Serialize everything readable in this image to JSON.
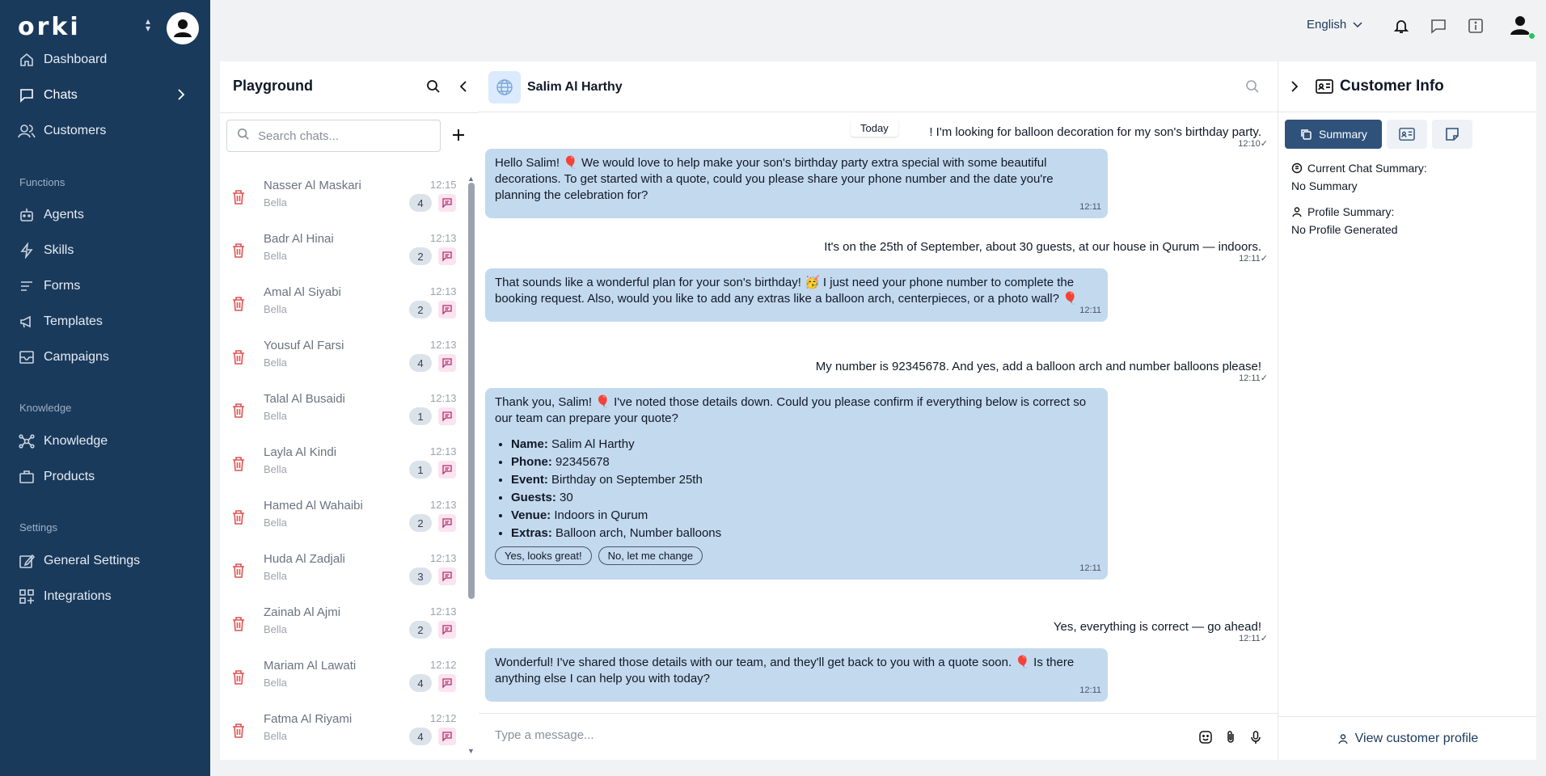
{
  "brand": {
    "logo": "orki"
  },
  "sidebar": {
    "items": [
      {
        "label": "Dashboard",
        "icon": "home-icon"
      },
      {
        "label": "Chats",
        "icon": "chat-icon"
      },
      {
        "label": "Customers",
        "icon": "users-icon"
      },
      {
        "label": "Agents",
        "icon": "robot-icon"
      },
      {
        "label": "Skills",
        "icon": "lightning-icon"
      },
      {
        "label": "Forms",
        "icon": "form-icon"
      },
      {
        "label": "Templates",
        "icon": "megaphone-icon"
      },
      {
        "label": "Campaigns",
        "icon": "mail-icon"
      },
      {
        "label": "Knowledge",
        "icon": "network-icon"
      },
      {
        "label": "Products",
        "icon": "briefcase-icon"
      },
      {
        "label": "General Settings",
        "icon": "pencil-icon"
      },
      {
        "label": "Integrations",
        "icon": "grid-plus-icon"
      }
    ],
    "sections": {
      "functions": "Functions",
      "knowledge": "Knowledge",
      "settings": "Settings"
    }
  },
  "topbar": {
    "language": "English"
  },
  "chat_list": {
    "title": "Playground",
    "search_placeholder": "Search chats...",
    "items": [
      {
        "name": "Nasser Al Maskari",
        "agent": "Bella",
        "time": "12:15",
        "count": "4"
      },
      {
        "name": "Badr Al Hinai",
        "agent": "Bella",
        "time": "12:13",
        "count": "2"
      },
      {
        "name": "Amal Al Siyabi",
        "agent": "Bella",
        "time": "12:13",
        "count": "2"
      },
      {
        "name": "Yousuf Al Farsi",
        "agent": "Bella",
        "time": "12:13",
        "count": "4"
      },
      {
        "name": "Talal Al Busaidi",
        "agent": "Bella",
        "time": "12:13",
        "count": "1"
      },
      {
        "name": "Layla Al Kindi",
        "agent": "Bella",
        "time": "12:13",
        "count": "1"
      },
      {
        "name": "Hamed Al Wahaibi",
        "agent": "Bella",
        "time": "12:13",
        "count": "2"
      },
      {
        "name": "Huda Al Zadjali",
        "agent": "Bella",
        "time": "12:13",
        "count": "3"
      },
      {
        "name": "Zainab Al Ajmi",
        "agent": "Bella",
        "time": "12:13",
        "count": "2"
      },
      {
        "name": "Mariam Al Lawati",
        "agent": "Bella",
        "time": "12:12",
        "count": "4"
      },
      {
        "name": "Fatma Al Riyami",
        "agent": "Bella",
        "time": "12:12",
        "count": "4"
      }
    ]
  },
  "chat": {
    "contact_name": "Salim Al Harthy",
    "date_pill": "Today",
    "composer_placeholder": "Type a message...",
    "messages": [
      {
        "from": "user",
        "text": "! I'm looking for balloon decoration for my son's birthday party.",
        "time": "12:10"
      },
      {
        "from": "bot",
        "text": "Hello Salim! 🎈 We would love to help make your son's birthday party extra special with some beautiful decorations. To get started with a quote, could you please share your phone number and the date you're planning the celebration for?",
        "time": "12:11"
      },
      {
        "from": "user",
        "text": "It's on the 25th of September, about 30 guests, at our house in Qurum — indoors.",
        "time": "12:11"
      },
      {
        "from": "bot",
        "text": "That sounds like a wonderful plan for your son's birthday! 🥳 I just need your phone number to complete the booking request. Also, would you like to add any extras like a balloon arch, centerpieces, or a photo wall? 🎈",
        "time": "12:11"
      },
      {
        "from": "user",
        "text": "My number is 92345678. And yes, add a balloon arch and number balloons please!",
        "time": "12:11"
      },
      {
        "from": "bot",
        "text": "Thank you, Salim! 🎈 I've noted those details down. Could you please confirm if everything below is correct so our team can prepare your quote?",
        "time": "12:11",
        "details": [
          {
            "label": "Name:",
            "value": "Salim Al Harthy"
          },
          {
            "label": "Phone:",
            "value": "92345678"
          },
          {
            "label": "Event:",
            "value": "Birthday on September 25th"
          },
          {
            "label": "Guests:",
            "value": "30"
          },
          {
            "label": "Venue:",
            "value": "Indoors in Qurum"
          },
          {
            "label": "Extras:",
            "value": "Balloon arch, Number balloons"
          }
        ],
        "quick_replies": [
          "Yes, looks great!",
          "No, let me change"
        ]
      },
      {
        "from": "user",
        "text": "Yes, everything is correct — go ahead!",
        "time": "12:11"
      },
      {
        "from": "bot",
        "text": "Wonderful! I've shared those details with our team, and they'll get back to you with a quote soon. 🎈 Is there anything else I can help you with today?",
        "time": "12:11"
      }
    ]
  },
  "customer_info": {
    "title": "Customer Info",
    "tab_summary": "Summary",
    "current_summary_label": "Current Chat Summary:",
    "current_summary_value": "No Summary",
    "profile_summary_label": "Profile Summary:",
    "profile_summary_value": "No Profile Generated",
    "view_profile": "View customer profile"
  },
  "colors": {
    "sidebar": "#1a3a5c",
    "bot_bubble": "#c3d9ee",
    "accent": "#2f527b",
    "delete": "#e05252"
  }
}
